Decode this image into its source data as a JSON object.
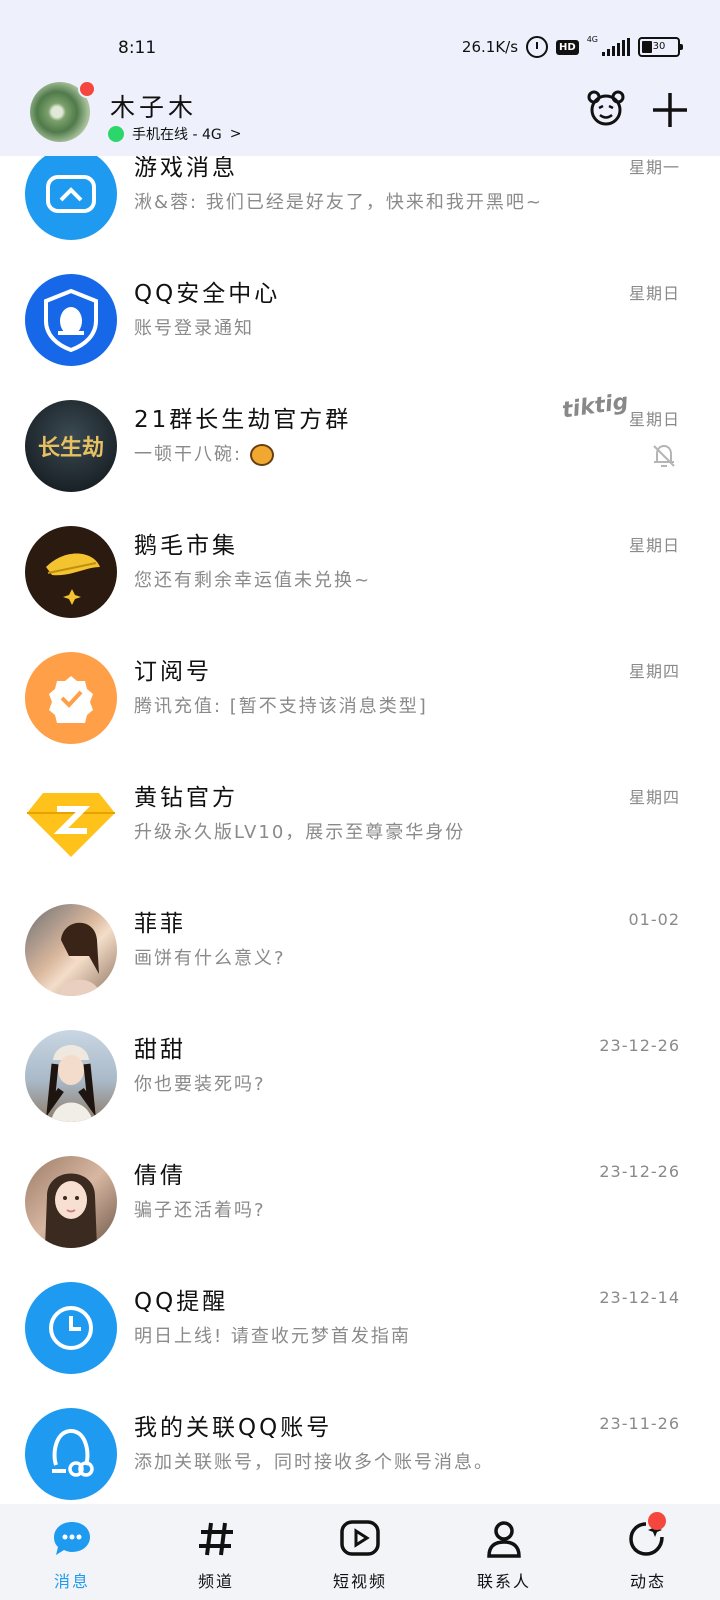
{
  "status_bar": {
    "time": "8:11",
    "network_speed": "26.1K/s",
    "hd_badge": "HD",
    "network_type": "4G",
    "battery": "30"
  },
  "header": {
    "nickname": "木子木",
    "online_status": "手机在线 - 4G",
    "chevron": ">"
  },
  "conversations": [
    {
      "title": "游戏消息",
      "subtitle": "湫&蓉: 我们已经是好友了，快来和我开黑吧~",
      "time": "星期一",
      "avatar_icon": "game-controller-icon",
      "avatar_color": "#1e9bf0"
    },
    {
      "title": "QQ安全中心",
      "subtitle": "账号登录通知",
      "time": "星期日",
      "avatar_icon": "shield-penguin-icon",
      "avatar_color": "#1768e8"
    },
    {
      "title": "21群长生劫官方群",
      "subtitle": "一顿干八碗: ",
      "time": "星期日",
      "avatar_icon": "group-logo-icon",
      "avatar_color": "#1d2a30",
      "avatar_text": "长生劫",
      "tag": "tiktig",
      "muted": true
    },
    {
      "title": "鹅毛市集",
      "subtitle": "您还有剩余幸运值未兑换~",
      "time": "星期日",
      "avatar_icon": "feather-icon",
      "avatar_color": "#2a1a10"
    },
    {
      "title": "订阅号",
      "subtitle": "腾讯充值: [暂不支持该消息类型]",
      "time": "星期四",
      "avatar_icon": "verified-badge-icon",
      "avatar_color": "#ff9f48"
    },
    {
      "title": "黄钻官方",
      "subtitle": "升级永久版LV10，展示至尊豪华身份",
      "time": "星期四",
      "avatar_icon": "yellow-diamond-icon",
      "avatar_color": "#ffffff"
    },
    {
      "title": "菲菲",
      "subtitle": "画饼有什么意义?",
      "time": "01-02",
      "avatar_icon": "user-photo-icon",
      "avatar_color": "#b28c74"
    },
    {
      "title": "甜甜",
      "subtitle": "你也要装死吗?",
      "time": "23-12-26",
      "avatar_icon": "user-photo-icon",
      "avatar_color": "#8fa3b5"
    },
    {
      "title": "倩倩",
      "subtitle": "骗子还活着吗?",
      "time": "23-12-26",
      "avatar_icon": "user-photo-icon",
      "avatar_color": "#c49a84"
    },
    {
      "title": "QQ提醒",
      "subtitle": "明日上线! 请查收元梦首发指南",
      "time": "23-12-14",
      "avatar_icon": "clock-icon",
      "avatar_color": "#1e9bf0"
    },
    {
      "title": "我的关联QQ账号",
      "subtitle": "添加关联账号，同时接收多个账号消息。",
      "time": "23-11-26",
      "avatar_icon": "linked-account-icon",
      "avatar_color": "#1e9bf0"
    }
  ],
  "tabs": [
    {
      "label": "消息",
      "icon": "message-bubble-icon",
      "active": true
    },
    {
      "label": "频道",
      "icon": "hashtag-icon",
      "active": false
    },
    {
      "label": "短视频",
      "icon": "video-play-icon",
      "active": false
    },
    {
      "label": "联系人",
      "icon": "contact-person-icon",
      "active": false
    },
    {
      "label": "动态",
      "icon": "refresh-star-icon",
      "active": false,
      "badge": true
    }
  ],
  "colors": {
    "accent": "#1e9bf0",
    "header_bg": "#eef1fb",
    "badge_red": "#f5473e",
    "online_green": "#2bd66a",
    "secondary_text": "#8a8a8a"
  }
}
